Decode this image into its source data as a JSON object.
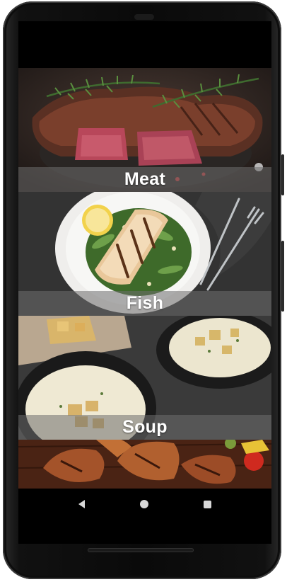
{
  "app": {
    "categories": [
      {
        "label": "Meat",
        "image": "grilled-steak-image"
      },
      {
        "label": "Fish",
        "image": "grilled-fish-plate-image"
      },
      {
        "label": "Soup",
        "image": "cream-soup-bowls-image"
      },
      {
        "label": "",
        "image": "grilled-chicken-image"
      }
    ]
  },
  "nav": {
    "back_icon": "back-triangle-icon",
    "home_icon": "home-circle-icon",
    "recents_icon": "recents-square-icon"
  },
  "colors": {
    "label_bar": "#6e6e6e",
    "screen_bg": "#000000",
    "nav_icons": "#d8d8d8"
  }
}
